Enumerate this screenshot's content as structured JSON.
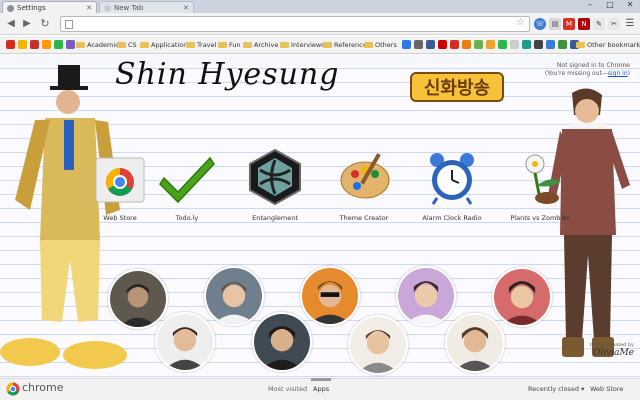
{
  "tabs": [
    {
      "label": "Settings",
      "active": true
    },
    {
      "label": "New Tab",
      "active": false
    }
  ],
  "omnibox": {
    "value": "",
    "placeholder": ""
  },
  "bookmarks": {
    "folders": [
      "Academic",
      "CS",
      "Application",
      "Travel",
      "Fun",
      "Archive",
      "Interviews",
      "Reference",
      "Others"
    ],
    "other": "Other bookmarks"
  },
  "content": {
    "title": "Shin Hyesung",
    "logo_text": "신화방송",
    "signin": {
      "line1": "Not signed in to Chrome",
      "line2": "(You're missing out—",
      "link": "sign in",
      "line2_end": ")"
    },
    "apps": [
      {
        "label": "Web Store",
        "icon": "chrome-web-store-icon"
      },
      {
        "label": "Todo.ly",
        "icon": "checkmark-icon"
      },
      {
        "label": "Entanglement",
        "icon": "hexagon-game-icon"
      },
      {
        "label": "Theme Creator",
        "icon": "paint-palette-icon"
      },
      {
        "label": "Alarm Clock Radio",
        "icon": "alarm-clock-icon"
      },
      {
        "label": "Plants vs Zombies",
        "icon": "plant-icon"
      }
    ],
    "watermark": {
      "small": "theme created by",
      "name": "OliviaMe"
    }
  },
  "footer": {
    "brand": "chrome",
    "most_visited": "Most visited",
    "apps": "Apps",
    "recently_closed": "Recently closed",
    "web_store": "Web Store"
  },
  "colors": {
    "tab_strip": "#cdd3de",
    "page_line": "#cfd9ef",
    "link": "#1155cc"
  }
}
